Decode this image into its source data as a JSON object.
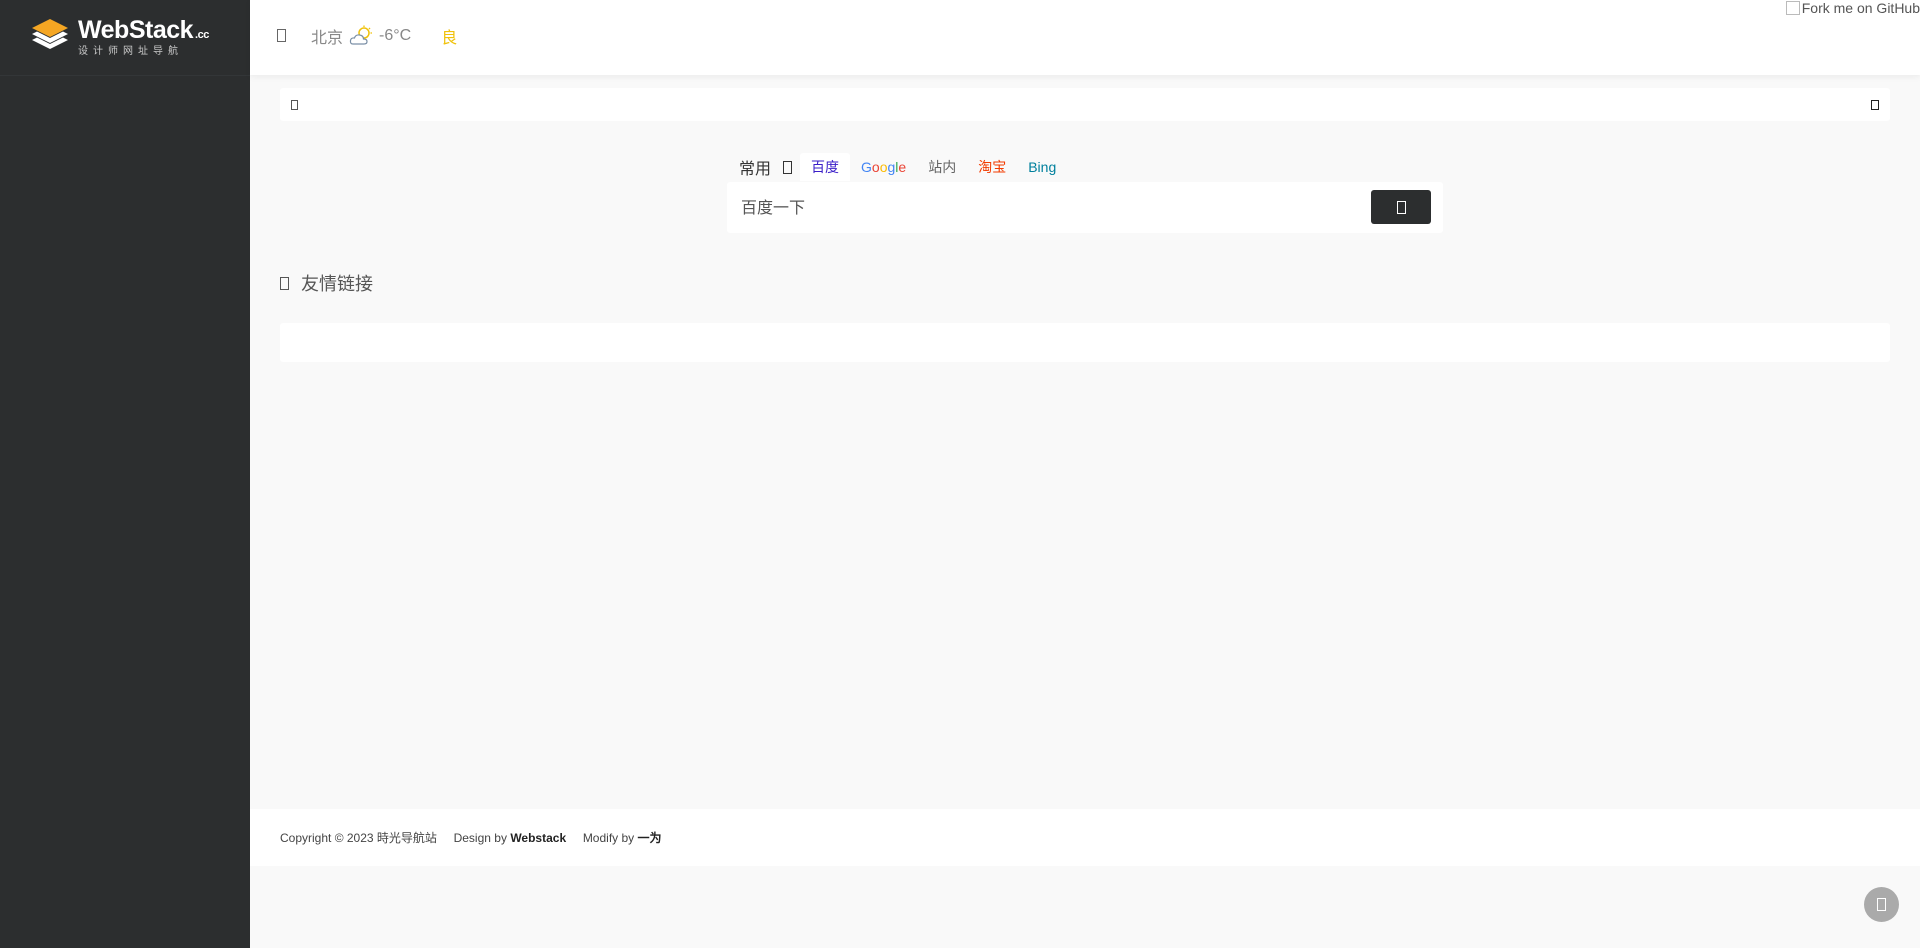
{
  "sidebar": {
    "logo": {
      "brand": "WebStack",
      "suffix": ".cc",
      "tagline": "设计师网址导航"
    }
  },
  "topbar": {
    "weather": {
      "city": "北京",
      "temperature": "-6°C",
      "air_quality": "良",
      "icon": "cloudy-icon"
    },
    "fork_badge": "Fork me on GitHub"
  },
  "search": {
    "group_label": "常用",
    "engines": [
      {
        "label": "百度",
        "color": "#3a1ec8",
        "active": true
      },
      {
        "label": "Google",
        "color": "#4285f4",
        "active": false
      },
      {
        "label": "站内",
        "color": "#666666",
        "active": false
      },
      {
        "label": "淘宝",
        "color": "#f23b00",
        "active": false
      },
      {
        "label": "Bing",
        "color": "#00809d",
        "active": false
      }
    ],
    "placeholder": "百度一下"
  },
  "section": {
    "title": "友情链接"
  },
  "footer": {
    "copyright": "Copyright © 2023 時光导航站",
    "design_prefix": "Design by",
    "design_name": "Webstack",
    "modify_prefix": "Modify by",
    "modify_name": "一为"
  },
  "colors": {
    "sidebar_bg": "#2c2e2f",
    "page_bg": "#f9f9f9",
    "accent_yellow": "#f0c20c"
  }
}
